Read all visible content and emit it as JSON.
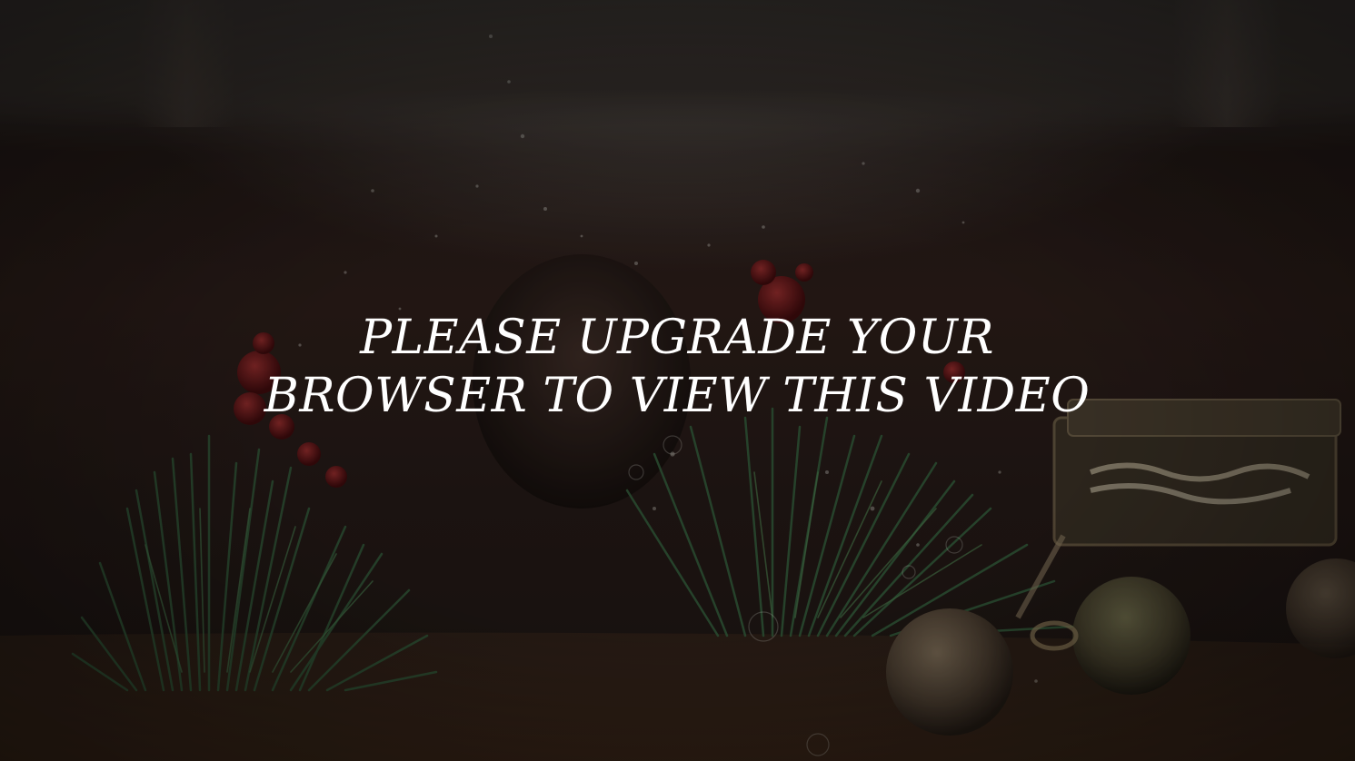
{
  "video": {
    "fallback_message": {
      "line1": "PLEASE UPGRADE YOUR",
      "line2": "BROWSER TO VIEW THIS VIDEO"
    }
  },
  "colors": {
    "text": "#ffffff",
    "background": "#1a1512",
    "pine": "#2d4a2f",
    "berry": "#6a1418",
    "ornament": "#6b5a44"
  }
}
